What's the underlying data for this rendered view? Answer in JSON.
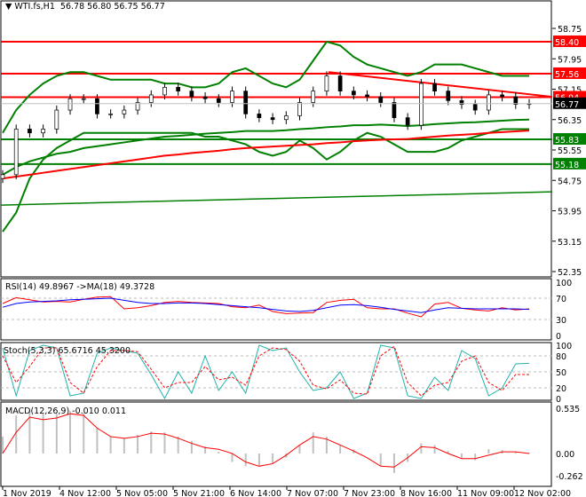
{
  "header": {
    "symbol": "WTI.fs,H1",
    "ohlc": "56.78 56.80 56.75 56.77"
  },
  "colors": {
    "resistance": "#ff0000",
    "support": "#008000",
    "bands": "#008000",
    "bid": "#000000",
    "rsi": "#ff0000",
    "rsi_ma": "#0000ff",
    "stoch_main": "#20b2aa",
    "stoch_signal": "#ff0000",
    "macd_hist": "#c0c0c0",
    "macd_signal": "#ff0000"
  },
  "chart_data": [
    {
      "type": "line",
      "name": "price",
      "ylim": [
        52.35,
        58.75
      ],
      "y_ticks": [
        "58.75",
        "57.95",
        "57.15",
        "56.35",
        "55.55",
        "54.75",
        "53.95",
        "53.15",
        "52.35"
      ],
      "x_ticks": [
        "1 Nov 2019",
        "4 Nov 12:00",
        "5 Nov 05:00",
        "5 Nov 21:00",
        "6 Nov 14:00",
        "7 Nov 07:00",
        "7 Nov 23:00",
        "8 Nov 16:00",
        "11 Nov 09:00",
        "12 Nov 02:00"
      ],
      "close": [
        54.9,
        56.1,
        56.0,
        56.1,
        56.6,
        56.9,
        56.9,
        56.5,
        56.5,
        56.6,
        56.8,
        57.0,
        57.2,
        57.1,
        56.95,
        56.9,
        56.8,
        57.1,
        56.5,
        56.4,
        56.35,
        56.45,
        56.8,
        57.1,
        57.5,
        57.1,
        57.0,
        56.95,
        56.8,
        56.4,
        56.2,
        57.3,
        57.1,
        56.85,
        56.75,
        56.6,
        57.0,
        56.95,
        56.75,
        56.77
      ],
      "bb_upper": [
        56.0,
        56.6,
        57.0,
        57.3,
        57.5,
        57.6,
        57.6,
        57.5,
        57.4,
        57.4,
        57.4,
        57.4,
        57.3,
        57.3,
        57.2,
        57.2,
        57.3,
        57.6,
        57.7,
        57.5,
        57.3,
        57.2,
        57.4,
        57.9,
        58.4,
        58.3,
        58.0,
        57.8,
        57.7,
        57.6,
        57.5,
        57.6,
        57.8,
        57.8,
        57.8,
        57.7,
        57.6,
        57.5,
        57.5,
        57.5
      ],
      "bb_lower": [
        53.4,
        53.9,
        54.8,
        55.3,
        55.6,
        55.8,
        56.0,
        56.0,
        56.0,
        56.0,
        56.0,
        56.0,
        56.0,
        56.0,
        56.0,
        55.9,
        55.9,
        55.8,
        55.7,
        55.5,
        55.4,
        55.5,
        55.8,
        55.6,
        55.3,
        55.5,
        55.8,
        56.0,
        55.9,
        55.7,
        55.5,
        55.5,
        55.5,
        55.6,
        55.8,
        55.9,
        56.0,
        56.1,
        56.1,
        56.1
      ],
      "ma_long_green": [
        54.9,
        55.1,
        55.25,
        55.35,
        55.45,
        55.5,
        55.6,
        55.65,
        55.7,
        55.75,
        55.8,
        55.85,
        55.9,
        55.92,
        55.95,
        55.98,
        56.0,
        56.02,
        56.05,
        56.05,
        56.05,
        56.07,
        56.1,
        56.12,
        56.15,
        56.17,
        56.2,
        56.2,
        56.22,
        56.2,
        56.18,
        56.2,
        56.23,
        56.25,
        56.27,
        56.28,
        56.3,
        56.32,
        56.34,
        56.35
      ],
      "ma_long_red": [
        54.8,
        54.85,
        54.9,
        54.95,
        55.0,
        55.05,
        55.1,
        55.15,
        55.2,
        55.25,
        55.3,
        55.35,
        55.4,
        55.43,
        55.47,
        55.5,
        55.53,
        55.57,
        55.6,
        55.62,
        55.64,
        55.66,
        55.68,
        55.7,
        55.73,
        55.75,
        55.78,
        55.8,
        55.82,
        55.83,
        55.84,
        55.87,
        55.9,
        55.93,
        55.95,
        55.97,
        56.0,
        56.02,
        56.04,
        56.06
      ],
      "trend_support": [
        54.1,
        54.45
      ],
      "trend_resistance": [
        57.6,
        56.95
      ],
      "levels": [
        {
          "value": "58.40",
          "kind": "resistance"
        },
        {
          "value": "57.56",
          "kind": "resistance"
        },
        {
          "value": "56.94",
          "kind": "resistance"
        },
        {
          "value": "55.83",
          "kind": "support"
        },
        {
          "value": "55.18",
          "kind": "support"
        }
      ],
      "bid": "56.77"
    },
    {
      "type": "line",
      "name": "RSI(14)",
      "label": "RSI(14) 49.8967  ->MA(18) 49.3728",
      "ylim": [
        0,
        100
      ],
      "y_ticks": [
        "100",
        "70",
        "30",
        "0"
      ],
      "rsi": [
        60,
        71,
        67,
        63,
        64,
        63,
        68,
        72,
        73,
        50,
        52,
        56,
        62,
        64,
        62,
        61,
        60,
        54,
        52,
        57,
        45,
        41,
        42,
        43,
        62,
        66,
        68,
        52,
        50,
        50,
        42,
        35,
        59,
        62,
        51,
        48,
        46,
        52,
        48,
        50
      ],
      "ma": [
        53,
        60,
        63,
        64,
        65,
        67,
        68,
        69,
        70,
        66,
        62,
        60,
        60,
        61,
        61,
        60,
        58,
        56,
        54,
        52,
        49,
        46,
        45,
        47,
        52,
        57,
        58,
        56,
        53,
        49,
        46,
        43,
        48,
        52,
        51,
        50,
        50,
        50,
        50,
        49
      ]
    },
    {
      "type": "line",
      "name": "Stoch(5,3,3)",
      "label": "Stoch(5,3,3) 65.6716 45.3200",
      "ylim": [
        0,
        100
      ],
      "y_ticks": [
        "100",
        "80",
        "50",
        "20",
        "0"
      ],
      "main": [
        95,
        5,
        90,
        100,
        95,
        5,
        10,
        85,
        95,
        90,
        85,
        45,
        0,
        50,
        10,
        80,
        15,
        50,
        10,
        100,
        90,
        95,
        50,
        15,
        20,
        50,
        0,
        10,
        100,
        95,
        5,
        0,
        40,
        15,
        90,
        75,
        5,
        20,
        65,
        66
      ],
      "signal": [
        80,
        30,
        60,
        95,
        95,
        30,
        10,
        60,
        90,
        90,
        88,
        55,
        20,
        30,
        30,
        60,
        35,
        40,
        25,
        80,
        95,
        92,
        70,
        25,
        18,
        35,
        10,
        8,
        80,
        98,
        30,
        5,
        25,
        30,
        70,
        80,
        30,
        15,
        45,
        45
      ]
    },
    {
      "type": "bar+line",
      "name": "MACD(12,26,9)",
      "label": "MACD(12,26,9) -0.010 0.011",
      "ylim": [
        -0.262,
        0.535
      ],
      "y_ticks": [
        "0.535",
        "0.00",
        "-0.262"
      ],
      "hist": [
        0.2,
        0.45,
        0.5,
        0.48,
        0.47,
        0.5,
        0.48,
        0.3,
        0.2,
        0.18,
        0.22,
        0.26,
        0.25,
        0.2,
        0.15,
        0.08,
        0.02,
        -0.1,
        -0.15,
        -0.15,
        -0.12,
        -0.05,
        0.1,
        0.25,
        0.2,
        0.1,
        0.05,
        0.0,
        -0.15,
        -0.23,
        -0.1,
        0.12,
        0.1,
        0.03,
        -0.05,
        -0.08,
        0.05,
        0.04,
        0.02,
        0.01
      ],
      "signal": [
        0.0,
        0.25,
        0.43,
        0.4,
        0.42,
        0.47,
        0.45,
        0.3,
        0.2,
        0.18,
        0.2,
        0.24,
        0.23,
        0.18,
        0.12,
        0.07,
        0.05,
        0.0,
        -0.1,
        -0.15,
        -0.12,
        -0.02,
        0.1,
        0.2,
        0.17,
        0.1,
        0.03,
        -0.05,
        -0.15,
        -0.16,
        -0.05,
        0.08,
        0.07,
        0.0,
        -0.06,
        -0.06,
        -0.02,
        0.02,
        0.02,
        0.0
      ]
    }
  ]
}
